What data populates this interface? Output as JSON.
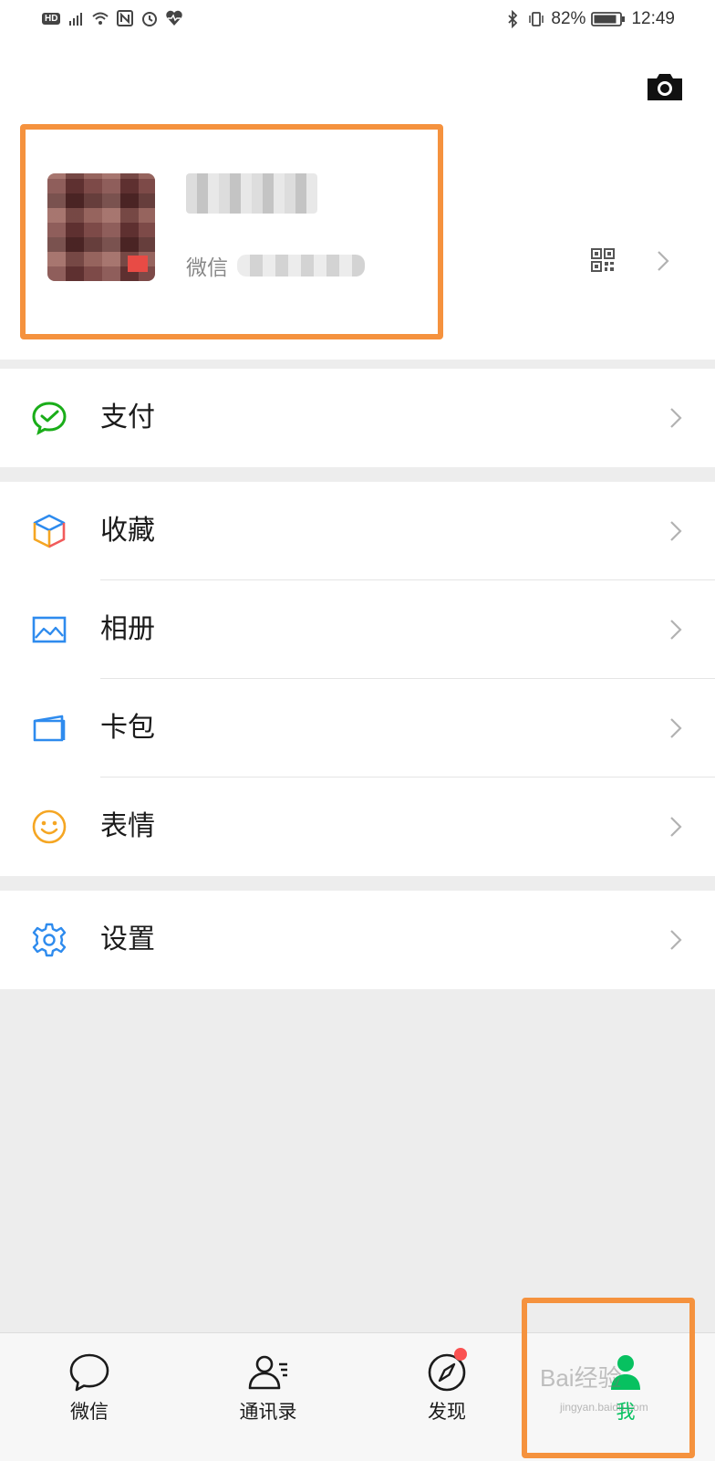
{
  "status_bar": {
    "left_icons": [
      "hd-icon",
      "4g-signal-icon",
      "wifi-icon",
      "nfc-icon",
      "alarm-icon",
      "heart-rate-icon"
    ],
    "hd_text": "HD",
    "battery_percent": "82%",
    "time": "12:49"
  },
  "profile": {
    "wechat_id_prefix": "微信"
  },
  "menu": {
    "pay": "支付",
    "favorites": "收藏",
    "album": "相册",
    "cards": "卡包",
    "stickers": "表情",
    "settings": "设置"
  },
  "tabbar": {
    "items": [
      {
        "label": "微信",
        "icon": "chat-bubble-icon"
      },
      {
        "label": "通讯录",
        "icon": "contacts-icon"
      },
      {
        "label": "发现",
        "icon": "compass-icon"
      },
      {
        "label": "我",
        "icon": "person-icon"
      }
    ],
    "active_index": 3,
    "active_color": "#07c160"
  },
  "watermark": {
    "main": "Bai经验",
    "sub": "jingyan.baidu.com"
  },
  "colors": {
    "highlight": "#f5923e",
    "brand_green": "#07c160",
    "badge_red": "#fa5151"
  }
}
